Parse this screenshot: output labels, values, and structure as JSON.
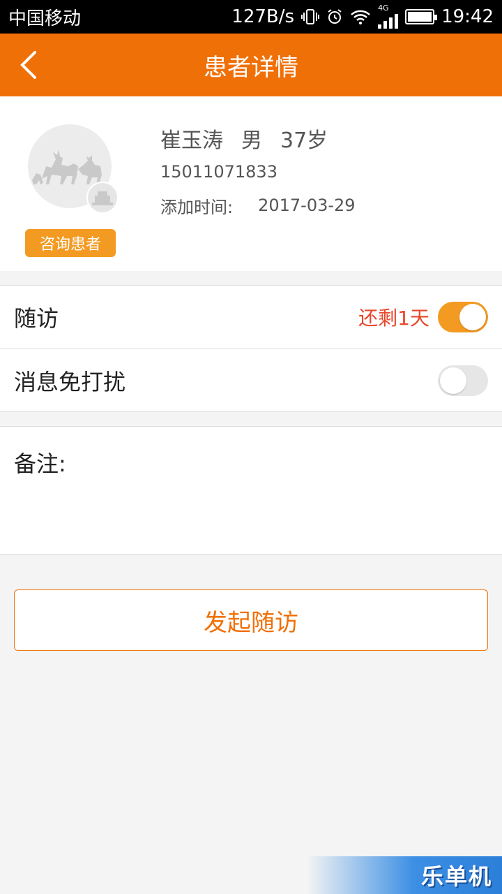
{
  "status_bar": {
    "carrier": "中国移动",
    "speed": "127B/s",
    "network": "4G",
    "time": "19:42"
  },
  "header": {
    "title": "患者详情"
  },
  "patient": {
    "name": "崔玉涛",
    "gender": "男",
    "age": "37岁",
    "phone": "15011071833",
    "added_label": "添加时间:",
    "added_date": "2017-03-29",
    "tag": "咨询患者"
  },
  "settings": {
    "followup": {
      "label": "随访",
      "remaining": "还剩1天",
      "enabled": true
    },
    "dnd": {
      "label": "消息免打扰",
      "enabled": false
    }
  },
  "note": {
    "label": "备注:"
  },
  "action": {
    "start_followup": "发起随访"
  },
  "watermark": {
    "text": "乐单机"
  },
  "colors": {
    "accent": "#f07008",
    "tag": "#f39a22",
    "remaining": "#e8472b"
  }
}
